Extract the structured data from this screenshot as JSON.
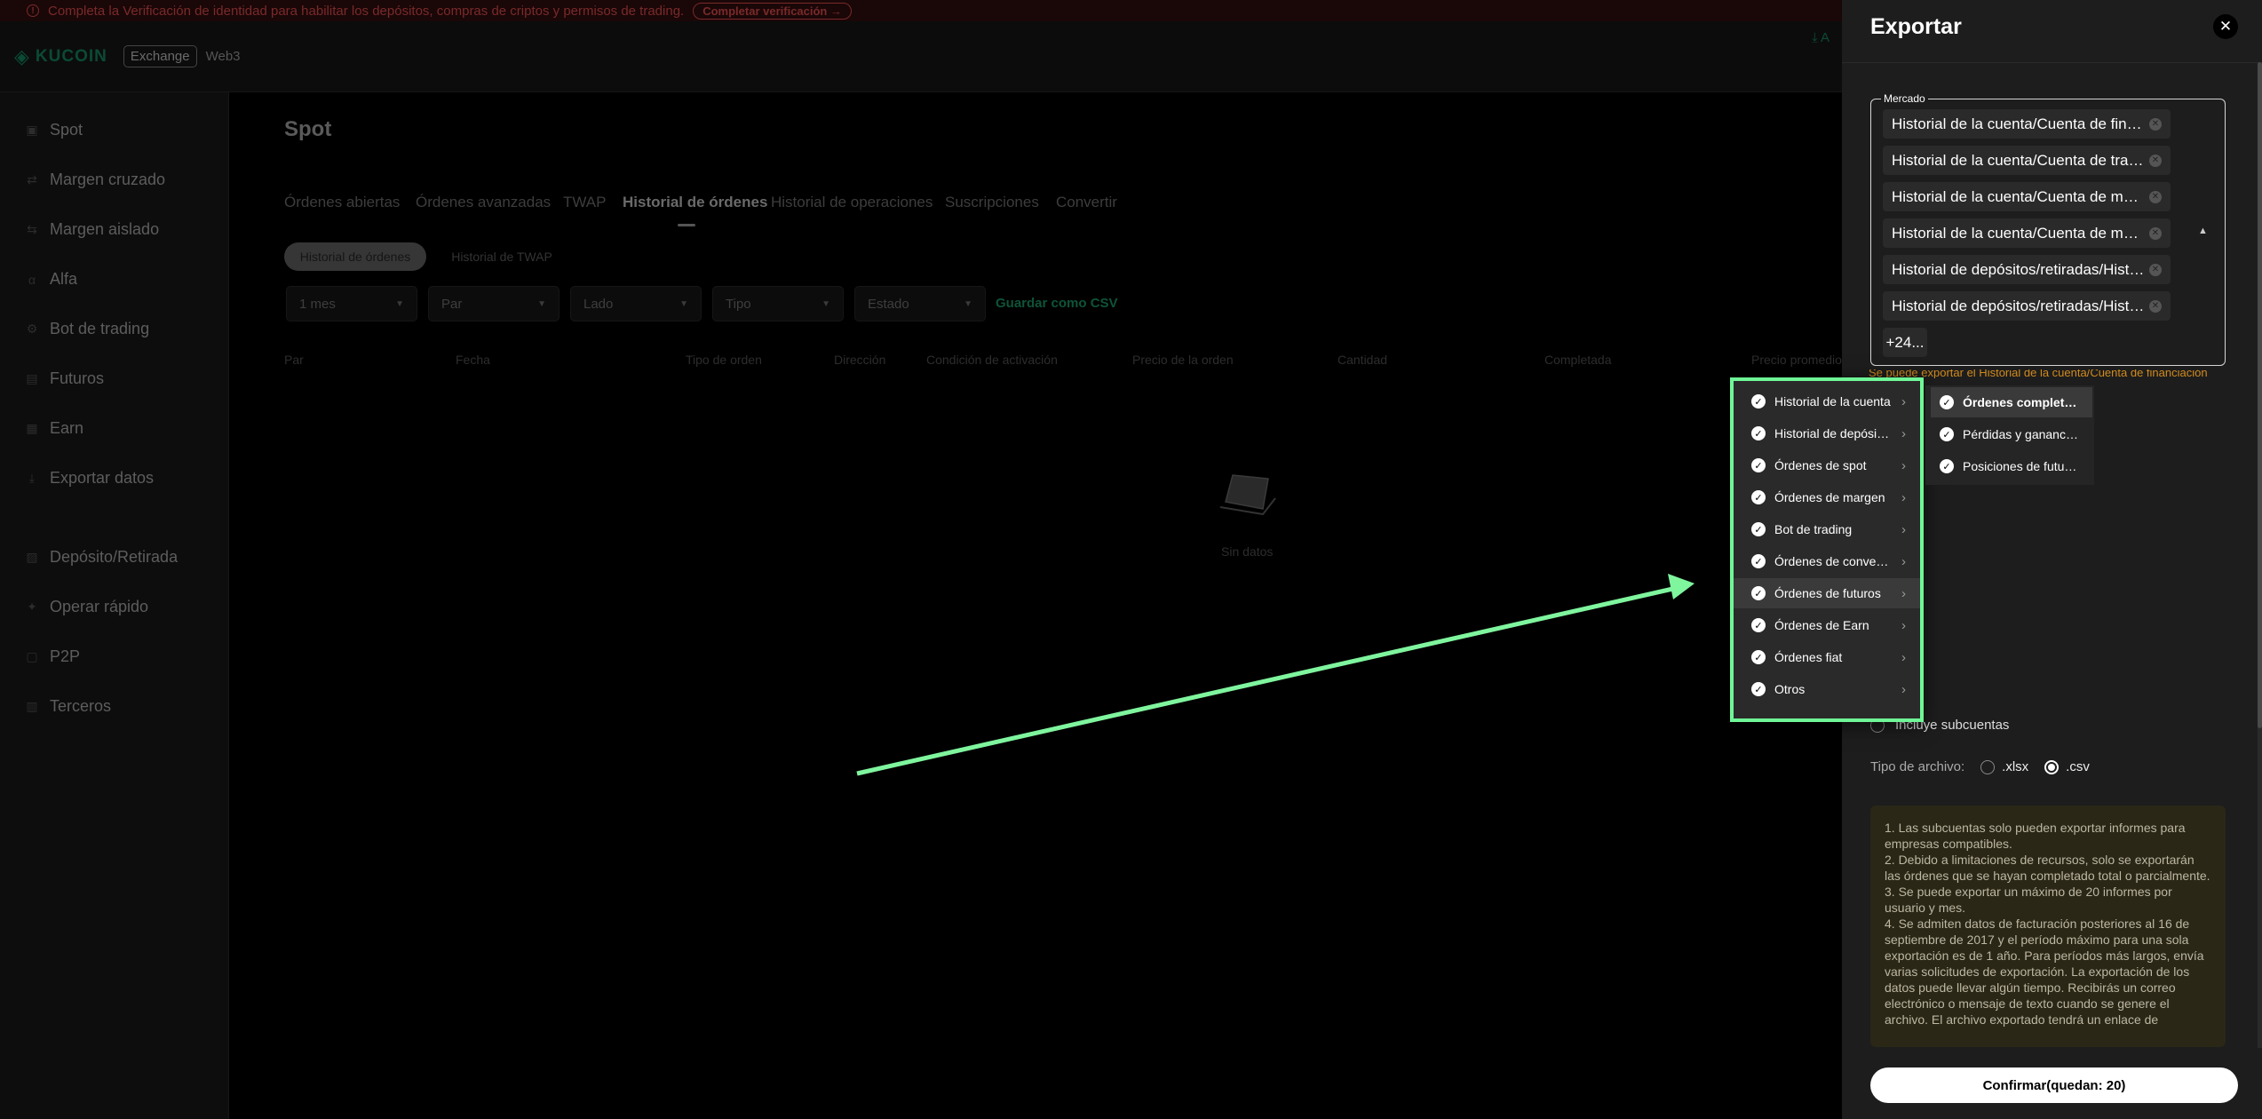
{
  "banner": {
    "message": "Completa la Verificación de identidad para habilitar los depósitos, compras de criptos y permisos de trading.",
    "button": "Completar verificación →"
  },
  "topbar": {
    "logo": "KUCOIN",
    "exchange": "Exchange",
    "web3": "Web3",
    "right_fragment": "A"
  },
  "sidebar": {
    "items": [
      {
        "label": "Spot"
      },
      {
        "label": "Margen cruzado"
      },
      {
        "label": "Margen aislado"
      },
      {
        "label": "Alfa"
      },
      {
        "label": "Bot de trading"
      },
      {
        "label": "Futuros"
      },
      {
        "label": "Earn"
      },
      {
        "label": "Exportar datos"
      },
      {
        "label": "Depósito/Retirada"
      },
      {
        "label": "Operar rápido"
      },
      {
        "label": "P2P"
      },
      {
        "label": "Terceros"
      }
    ]
  },
  "main": {
    "title": "Spot",
    "tabs": [
      {
        "label": "Órdenes abiertas"
      },
      {
        "label": "Órdenes avanzadas"
      },
      {
        "label": "TWAP"
      },
      {
        "label": "Historial de órdenes"
      },
      {
        "label": "Historial de operaciones"
      },
      {
        "label": "Suscripciones"
      },
      {
        "label": "Convertir"
      }
    ],
    "pills": [
      {
        "label": "Historial de órdenes"
      },
      {
        "label": "Historial de TWAP"
      }
    ],
    "filters": [
      {
        "label": "1 mes"
      },
      {
        "label": "Par"
      },
      {
        "label": "Lado"
      },
      {
        "label": "Tipo"
      },
      {
        "label": "Estado"
      }
    ],
    "save_csv": "Guardar como CSV",
    "columns": [
      "Par",
      "Fecha",
      "Tipo de orden",
      "Dirección",
      "Condición de activación",
      "Precio de la orden",
      "Cantidad",
      "Completada",
      "Precio promedio"
    ],
    "empty": "Sin datos"
  },
  "dropdown": {
    "items": [
      {
        "label": "Historial de la cuenta"
      },
      {
        "label": "Historial de depósitos/retiradas"
      },
      {
        "label": "Órdenes de spot"
      },
      {
        "label": "Órdenes de margen"
      },
      {
        "label": "Bot de trading"
      },
      {
        "label": "Órdenes de conversión"
      },
      {
        "label": "Órdenes de futuros"
      },
      {
        "label": "Órdenes de Earn"
      },
      {
        "label": "Órdenes fiat"
      },
      {
        "label": "Otros"
      }
    ],
    "sub_items": [
      {
        "label": "Órdenes completadas"
      },
      {
        "label": "Pérdidas y ganancias"
      },
      {
        "label": "Posiciones de futuros"
      }
    ]
  },
  "panel": {
    "title": "Exportar",
    "market_label": "Mercado",
    "chips": [
      {
        "label": "Historial de la cuenta/Cuenta de financiación"
      },
      {
        "label": "Historial de la cuenta/Cuenta de trading"
      },
      {
        "label": "Historial de la cuenta/Cuenta de margen cruzado"
      },
      {
        "label": "Historial de la cuenta/Cuenta de margen aislado"
      },
      {
        "label": "Historial de depósitos/retiradas/Historial de depósitos"
      },
      {
        "label": "Historial de depósitos/retiradas/Historial de retiradas"
      }
    ],
    "more": "+24...",
    "hint": "Se puede exportar el Historial de la cuenta/Cuenta de financiación y...",
    "include_subaccounts": "Incluye subcuentas",
    "file_type_label": "Tipo de archivo:",
    "file_types": [
      ".xlsx",
      ".csv"
    ],
    "notice": [
      "1. Las subcuentas solo pueden exportar informes para empresas compatibles.",
      "2. Debido a limitaciones de recursos, solo se exportarán las órdenes que se hayan completado total o parcialmente.",
      "3. Se puede exportar un máximo de 20 informes por usuario y mes.",
      "4. Se admiten datos de facturación posteriores al 16 de septiembre de 2017 y el período máximo para una sola exportación es de 1 año. Para períodos más largos, envía varias solicitudes de exportación. La exportación de los datos puede llevar algún tiempo. Recibirás un correo electrónico o mensaje de texto cuando se genere el archivo. El archivo exportado tendrá un enlace de"
    ],
    "confirm": "Confirmar(quedan: 20)"
  }
}
